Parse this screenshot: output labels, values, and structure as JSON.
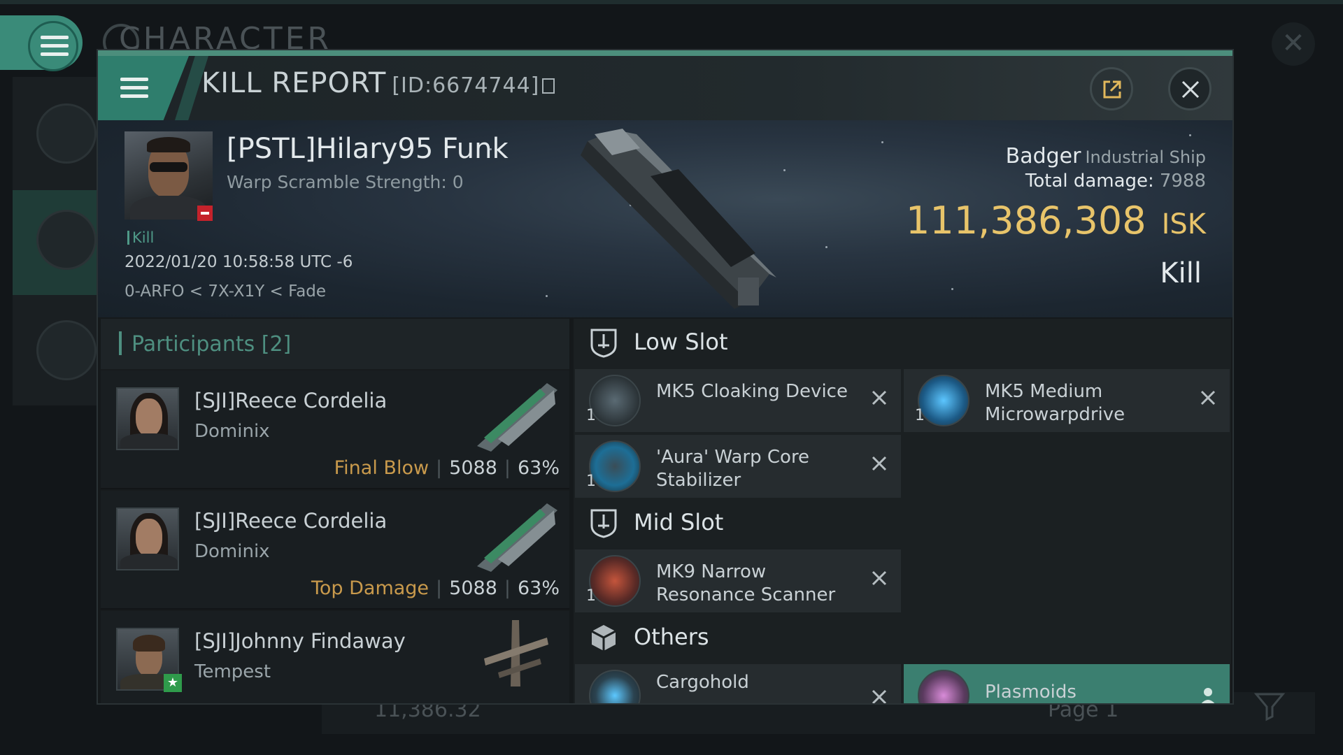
{
  "background": {
    "title": "CHARACTER",
    "bottom_value": "11,386.32",
    "page_label": "Page 1"
  },
  "header": {
    "title": "KILL REPORT",
    "report_id": "[ID:6674744]"
  },
  "victim": {
    "name": "[PSTL]Hilary95 Funk",
    "warp_scramble": "Warp Scramble Strength: 0",
    "tag": "Kill",
    "datetime": "2022/01/20 10:58:58 UTC -6",
    "location": "0-ARFO < 7X-X1Y < Fade",
    "ship_name": "Badger",
    "ship_class": "Industrial Ship",
    "total_damage_label": "Total damage:",
    "total_damage_value": "7988",
    "isk_value": "111,386,308",
    "isk_unit": "ISK",
    "result": "Kill"
  },
  "participants": {
    "header": "Participants [2]",
    "rows": [
      {
        "name": "[SJI]Reece Cordelia",
        "ship": "Dominix",
        "label": "Final Blow",
        "damage": "5088",
        "percent": "63%"
      },
      {
        "name": "[SJI]Reece Cordelia",
        "ship": "Dominix",
        "label": "Top Damage",
        "damage": "5088",
        "percent": "63%"
      },
      {
        "name": "[SJI]Johnny Findaway",
        "ship": "Tempest"
      }
    ]
  },
  "fitting": {
    "low_slot_label": "Low Slot",
    "mid_slot_label": "Mid Slot",
    "others_label": "Others",
    "low_items": [
      {
        "name": "MK5 Cloaking Device",
        "qty": "1"
      },
      {
        "name": "MK5 Medium Microwarpdrive",
        "qty": "1"
      },
      {
        "name": "'Aura' Warp Core Stabilizer",
        "qty": "1"
      }
    ],
    "mid_items": [
      {
        "name": "MK9 Narrow Resonance Scanner",
        "qty": "1"
      }
    ],
    "other_items": [
      {
        "name": "Cargohold"
      },
      {
        "name": "Plasmoids"
      }
    ]
  },
  "colors": {
    "accent": "#3a8b79",
    "isk": "#e8c46a",
    "final_blow": "#c99a4c",
    "selected_item": "#3b7f70"
  }
}
